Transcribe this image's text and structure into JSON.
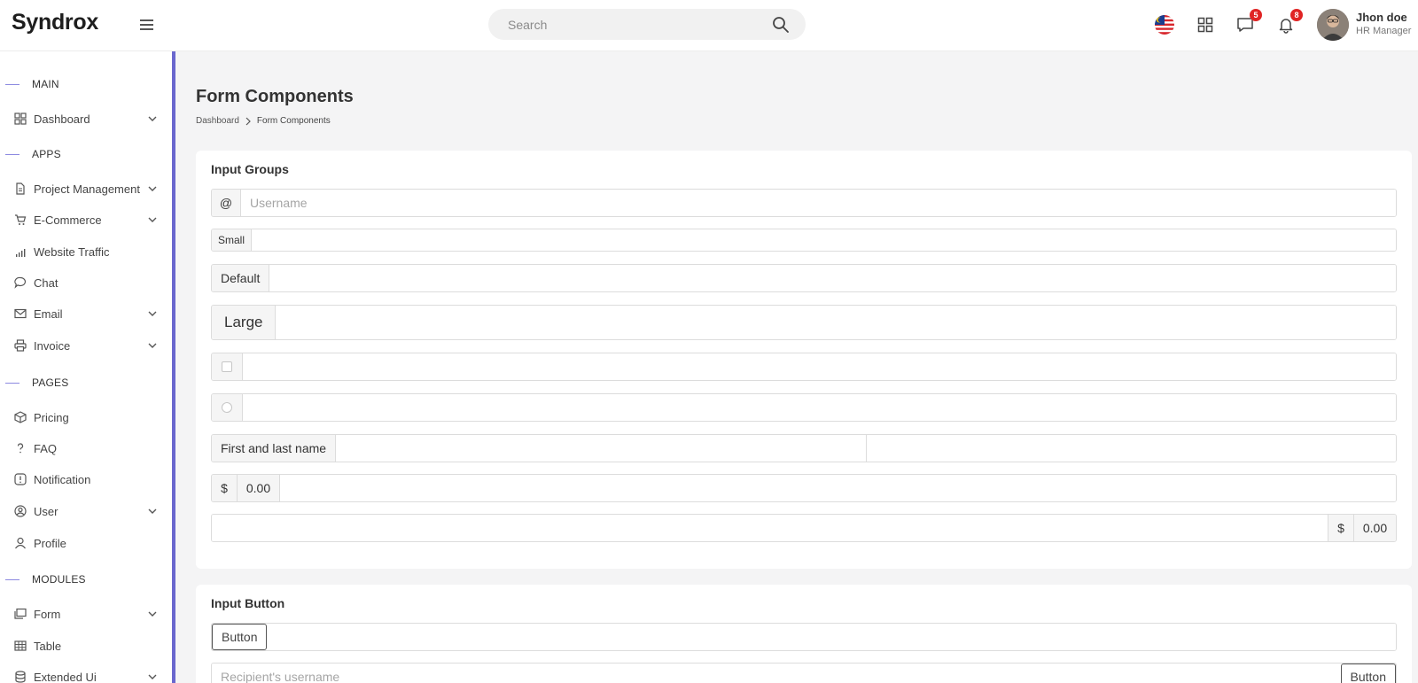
{
  "header": {
    "logo": "Syndrox",
    "search_placeholder": "Search",
    "messages_badge": "5",
    "notifications_badge": "8",
    "user_name": "Jhon doe",
    "user_role": "HR Manager"
  },
  "sidebar": {
    "sections": {
      "main": "MAIN",
      "apps": "APPS",
      "pages": "PAGES",
      "modules": "MODULES"
    },
    "items": [
      {
        "label": "Dashboard",
        "icon": "grid-icon",
        "has_chevron": true
      },
      {
        "label": "Project Management",
        "icon": "document-icon",
        "has_chevron": true
      },
      {
        "label": "E-Commerce",
        "icon": "cart-icon",
        "has_chevron": true
      },
      {
        "label": "Website Traffic",
        "icon": "bar-chart-icon",
        "has_chevron": false
      },
      {
        "label": "Chat",
        "icon": "chat-icon",
        "has_chevron": false
      },
      {
        "label": "Email",
        "icon": "mail-icon",
        "has_chevron": true
      },
      {
        "label": "Invoice",
        "icon": "printer-icon",
        "has_chevron": true
      },
      {
        "label": "Pricing",
        "icon": "package-icon",
        "has_chevron": false
      },
      {
        "label": "FAQ",
        "icon": "question-icon",
        "has_chevron": false
      },
      {
        "label": "Notification",
        "icon": "alert-icon",
        "has_chevron": false
      },
      {
        "label": "User",
        "icon": "user-circle-icon",
        "has_chevron": true
      },
      {
        "label": "Profile",
        "icon": "user-icon",
        "has_chevron": false
      },
      {
        "label": "Form",
        "icon": "form-icon",
        "has_chevron": true
      },
      {
        "label": "Table",
        "icon": "table-icon",
        "has_chevron": false
      },
      {
        "label": "Extended Ui",
        "icon": "database-icon",
        "has_chevron": true
      }
    ]
  },
  "main": {
    "title": "Form Components",
    "breadcrumb": [
      "Dashboard",
      "Form Components"
    ],
    "input_groups": {
      "title": "Input Groups",
      "at_addon": "@",
      "username_placeholder": "Username",
      "small_addon": "Small",
      "default_addon": "Default",
      "large_addon": "Large",
      "name_addon": "First and last name",
      "dollar_addon": "$",
      "amount_addon": "0.00"
    },
    "input_button": {
      "title": "Input Button",
      "button_label": "Button",
      "recipient_placeholder": "Recipient's username"
    }
  },
  "colors": {
    "accent": "#6a67ce",
    "badge": "#e02424"
  }
}
